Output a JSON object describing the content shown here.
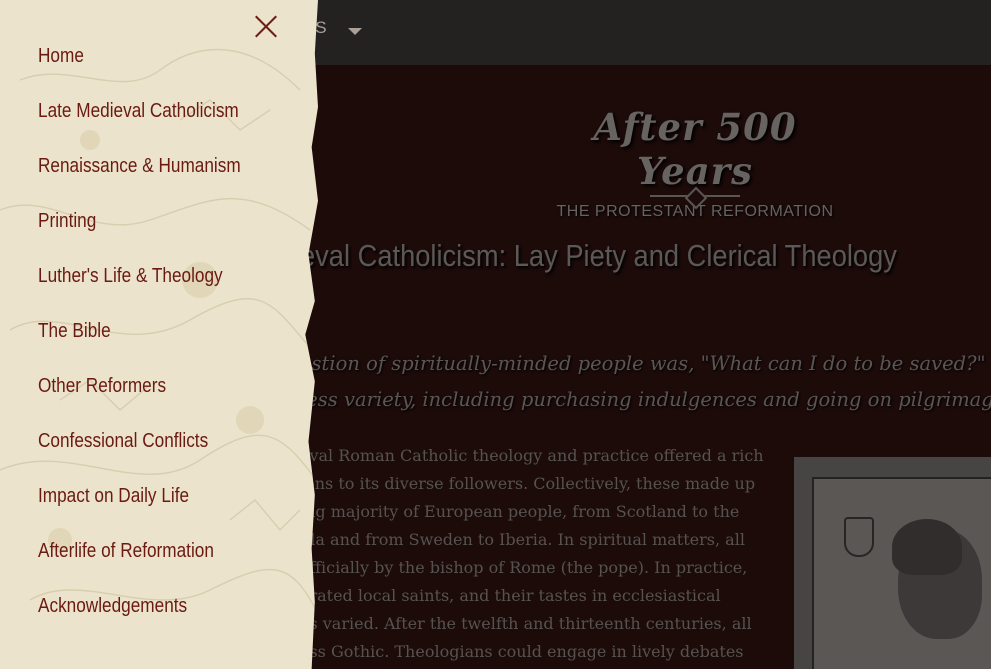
{
  "topbar": {
    "nav_label": "NS"
  },
  "logo": {
    "title": "After 500 Years",
    "subtitle": "THE PROTESTANT REFORMATION"
  },
  "page": {
    "heading": "eval Catholicism: Lay Piety and Clerical Theology",
    "intro_lines": [
      "estion of spiritually-minded people was, \"What can I do to be saved?\" They",
      "less variety, including purchasing indulgences and going on pilgrimages."
    ],
    "body_lines": [
      "eval Roman Catholic theology and practice offered a rich",
      "ions to its diverse followers. Collectively, these made up",
      "ing majority of European people, from Scotland to the",
      "ula and from Sweden to Iberia. In spiritual matters, all",
      "officially by the bishop of Rome (the pope). In practice,",
      "erated local saints, and their tastes in ecclesiastical",
      "es varied. After the twelfth and thirteenth centuries, all",
      "ess Gothic. Theologians could engage in lively debates"
    ]
  },
  "menu": {
    "items": [
      {
        "label": "Home"
      },
      {
        "label": "Late Medieval Catholicism"
      },
      {
        "label": "Renaissance & Humanism"
      },
      {
        "label": "Printing"
      },
      {
        "label": "Luther's Life & Theology"
      },
      {
        "label": "The Bible"
      },
      {
        "label": "Other Reformers"
      },
      {
        "label": "Confessional Conflicts"
      },
      {
        "label": "Impact on Daily Life"
      },
      {
        "label": "Afterlife of Reformation"
      },
      {
        "label": "Acknowledgements"
      }
    ]
  },
  "colors": {
    "menu_text": "#6b1a12",
    "drawer_bg": "#ebe3cc",
    "page_bg": "#2b110f"
  },
  "icons": {
    "close": "close-icon",
    "dropdown": "caret-down-icon"
  }
}
